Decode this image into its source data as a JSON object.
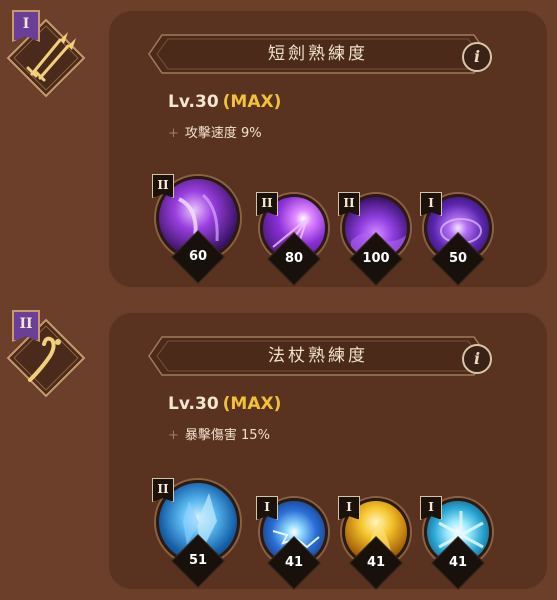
{
  "weapons": [
    {
      "tier": "I",
      "title": "短劍熟練度",
      "level": "Lv.30",
      "max_label": "(MAX)",
      "stat": "攻擊速度 9%",
      "icon": "dagger-icon",
      "skills": [
        {
          "tier": "II",
          "count": "60",
          "icon": "shadow-slash-icon",
          "theme": "purple"
        },
        {
          "tier": "II",
          "count": "80",
          "icon": "purple-burst-icon",
          "theme": "purple"
        },
        {
          "tier": "II",
          "count": "100",
          "icon": "void-wave-icon",
          "theme": "purple"
        },
        {
          "tier": "I",
          "count": "50",
          "icon": "galaxy-swirl-icon",
          "theme": "purple"
        }
      ]
    },
    {
      "tier": "II",
      "title": "法杖熟練度",
      "level": "Lv.30",
      "max_label": "(MAX)",
      "stat": "暴擊傷害 15%",
      "icon": "staff-icon",
      "skills": [
        {
          "tier": "II",
          "count": "51",
          "icon": "ice-shard-icon",
          "theme": "blue"
        },
        {
          "tier": "I",
          "count": "41",
          "icon": "lightning-orb-icon",
          "theme": "blue"
        },
        {
          "tier": "I",
          "count": "41",
          "icon": "holy-flame-icon",
          "theme": "gold"
        },
        {
          "tier": "I",
          "count": "41",
          "icon": "frost-nova-icon",
          "theme": "cyan"
        }
      ]
    }
  ],
  "colors": {
    "background": "#6b3f29",
    "panel": "#5a3320",
    "max_highlight": "#f0c23a",
    "tier_flag": "#6b3f98"
  },
  "info_icon": "info-icon"
}
